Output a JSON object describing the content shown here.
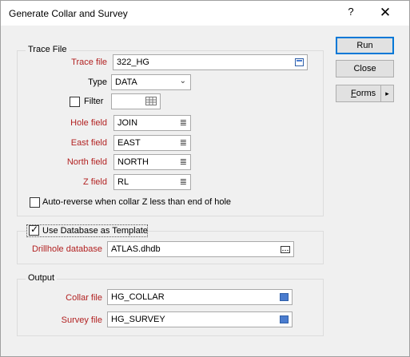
{
  "window": {
    "title": "Generate Collar and Survey",
    "help_label": "?",
    "close_label": "✕"
  },
  "trace_file": {
    "group_title": "Trace File",
    "trace_file_label": "Trace file",
    "trace_file_value": "322_HG",
    "type_label": "Type",
    "type_value": "DATA",
    "filter_label": "Filter",
    "filter_checked": false,
    "filter_value": "",
    "hole_field_label": "Hole field",
    "hole_field_value": "JOIN",
    "east_field_label": "East field",
    "east_field_value": "EAST",
    "north_field_label": "North field",
    "north_field_value": "NORTH",
    "z_field_label": "Z field",
    "z_field_value": "RL",
    "auto_reverse_label": "Auto-reverse when collar Z less than end of hole",
    "auto_reverse_checked": false
  },
  "database": {
    "use_template_label": "Use Database as Template",
    "use_template_checked": true,
    "drillhole_label": "Drillhole database",
    "drillhole_value": "ATLAS.dhdb"
  },
  "output": {
    "group_title": "Output",
    "collar_label": "Collar file",
    "collar_value": "HG_COLLAR",
    "survey_label": "Survey file",
    "survey_value": "HG_SURVEY"
  },
  "buttons": {
    "run": "Run",
    "close": "Close",
    "forms_first": "F",
    "forms_rest": "orms",
    "forms_arrow": "▶"
  },
  "colors": {
    "required_label": "#b22222",
    "accent": "#0078d7"
  }
}
